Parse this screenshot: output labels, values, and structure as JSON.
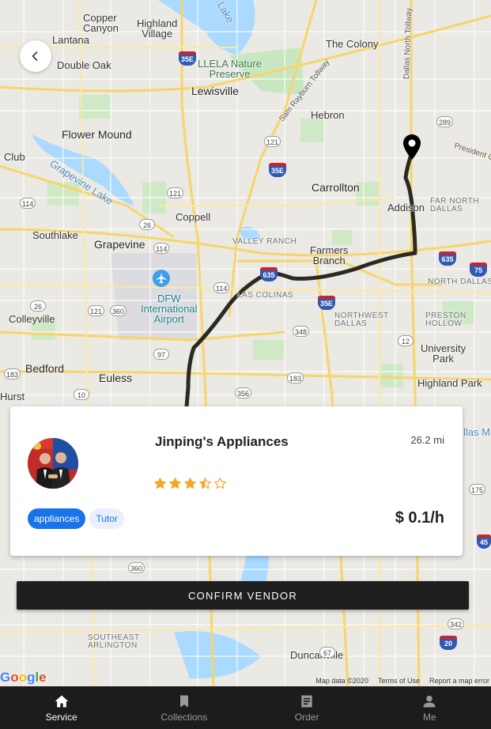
{
  "map": {
    "labels": {
      "copper_canyon": "Copper\nCanyon",
      "highland_village": "Highland\nVillage",
      "lantana": "Lantana",
      "double_oak": "Double Oak",
      "llela": "LLELA Nature\nPreserve",
      "lewisville": "Lewisville",
      "the_colony": "The Colony",
      "hebron": "Hebron",
      "flower_mound": "Flower Mound",
      "club": "Club",
      "grapevine_lake": "Grapevine Lake",
      "carrollton": "Carrollton",
      "addison": "Addison",
      "far_north_dallas": "FAR NORTH\nDALLAS",
      "coppell": "Coppell",
      "southlake": "Southlake",
      "grapevine": "Grapevine",
      "valley_ranch": "VALLEY RANCH",
      "farmers_branch": "Farmers\nBranch",
      "north_dallas": "NORTH DALLAS",
      "las_colinas": "LAS COLINAS",
      "dfw": "DFW\nInternational\nAirport",
      "colleyville": "Colleyville",
      "northwest_dallas": "NORTHWEST\nDALLAS",
      "preston_hollow": "PRESTON\nHOLLOW",
      "university_park": "University\nPark",
      "bedford": "Bedford",
      "euless": "Euless",
      "highland_park": "Highland Park",
      "hurst": "Hurst",
      "dallas_mu": "llas Mu",
      "southeast_arlington": "SOUTHEAST\nARLINGTON",
      "duncanville": "Duncanville",
      "sam_rayburn": "Sam Rayburn Tollway",
      "dallas_north": "Dallas North Tollway",
      "president_g": "President G",
      "lake": "Lake"
    },
    "footer": {
      "map_data": "Map data ©2020",
      "terms": "Terms of Use",
      "report": "Report a map error"
    },
    "google": "Google",
    "route_color": "#2b2a22"
  },
  "vendor": {
    "name": "Jinping's Appliances",
    "distance": "26.2 mi",
    "rating": 3.5,
    "rating_max": 5,
    "tags": [
      "appliances",
      "Tutor"
    ],
    "price": "$ 0.1/h"
  },
  "actions": {
    "confirm": "CONFIRM VENDOR"
  },
  "nav": {
    "items": [
      {
        "label": "Service",
        "icon": "home-icon",
        "active": true
      },
      {
        "label": "Collections",
        "icon": "bookmark-icon",
        "active": false
      },
      {
        "label": "Order",
        "icon": "document-icon",
        "active": false
      },
      {
        "label": "Me",
        "icon": "person-icon",
        "active": false
      }
    ]
  },
  "colors": {
    "accent": "#1a73e8",
    "star": "#f5a623",
    "nav_bg": "#1c1c1c",
    "button_bg": "#1f1f1f"
  }
}
